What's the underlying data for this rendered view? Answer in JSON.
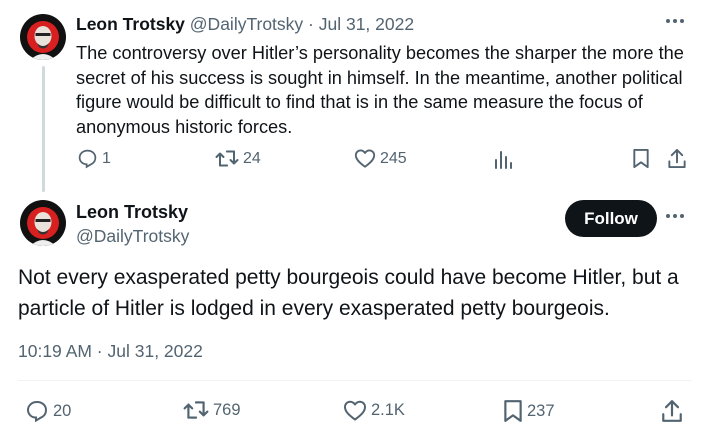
{
  "tweet1": {
    "author_name": "Leon Trotsky",
    "author_handle": "@DailyTrotsky",
    "separator": " · ",
    "date": "Jul 31, 2022",
    "text": "The controversy over Hitler’s personality becomes the sharper the more the secret of his success is sought in himself. In the meantime, another political figure would be difficult to find that is in the same measure the focus of anonymous historic forces.",
    "replies": "1",
    "retweets": "24",
    "likes": "245"
  },
  "tweet2": {
    "author_name": "Leon Trotsky",
    "author_handle": "@DailyTrotsky",
    "follow_label": "Follow",
    "text": "Not every exasperated petty bourgeois could have become Hitler, but a particle of Hitler is lodged in every exasperated petty bourgeois.",
    "timestamp": "10:19 AM · Jul 31, 2022",
    "replies": "20",
    "retweets": "769",
    "likes": "2.1K",
    "bookmarks": "237"
  },
  "icons": {
    "reply": "reply-icon",
    "retweet": "retweet-icon",
    "like": "heart-icon",
    "views": "views-icon",
    "bookmark": "bookmark-icon",
    "share": "share-icon",
    "more": "more-icon"
  },
  "colors": {
    "text_primary": "#0f1419",
    "text_secondary": "#536471",
    "avatar_red": "#d7201f",
    "follow_bg": "#0f1419"
  }
}
